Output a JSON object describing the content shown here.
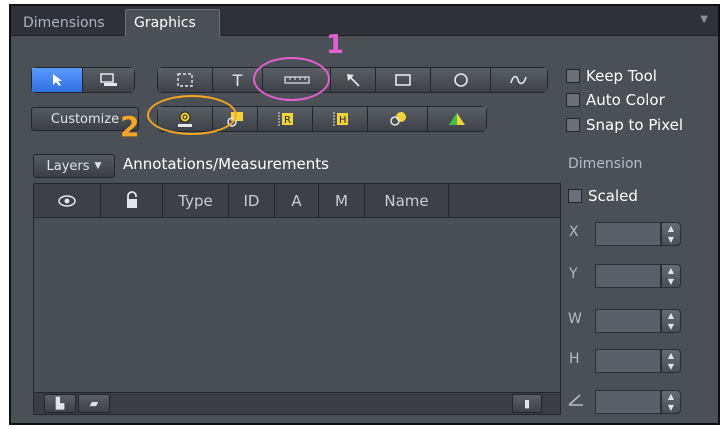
{
  "tabs": [
    {
      "label": "Dimensions"
    },
    {
      "label": "Graphics"
    }
  ],
  "tools_row1": [
    "Select",
    "Screen",
    "Rectangle Select",
    "Text",
    "Scale Bar",
    "Arrow",
    "Rectangle",
    "Circle",
    "Curve"
  ],
  "toolbar": {
    "customize_label": "Customize"
  },
  "options": {
    "keep_tool": "Keep Tool",
    "auto_color": "Auto Color",
    "snap_to_pixel": "Snap to Pixel"
  },
  "layers": {
    "button_label": "Layers",
    "title": "Annotations/Measurements"
  },
  "table": {
    "columns": [
      "",
      "",
      "Type",
      "ID",
      "A",
      "M",
      "Name"
    ]
  },
  "dimension": {
    "title": "Dimension",
    "scaled_label": "Scaled",
    "fields": [
      {
        "label": "X"
      },
      {
        "label": "Y"
      },
      {
        "label": "W"
      },
      {
        "label": "H"
      },
      {
        "label": ""
      }
    ]
  },
  "annotations": {
    "one": "1",
    "two": "2"
  },
  "colors": {
    "annotation_1": "#e060d0",
    "annotation_2": "#f5a623"
  }
}
